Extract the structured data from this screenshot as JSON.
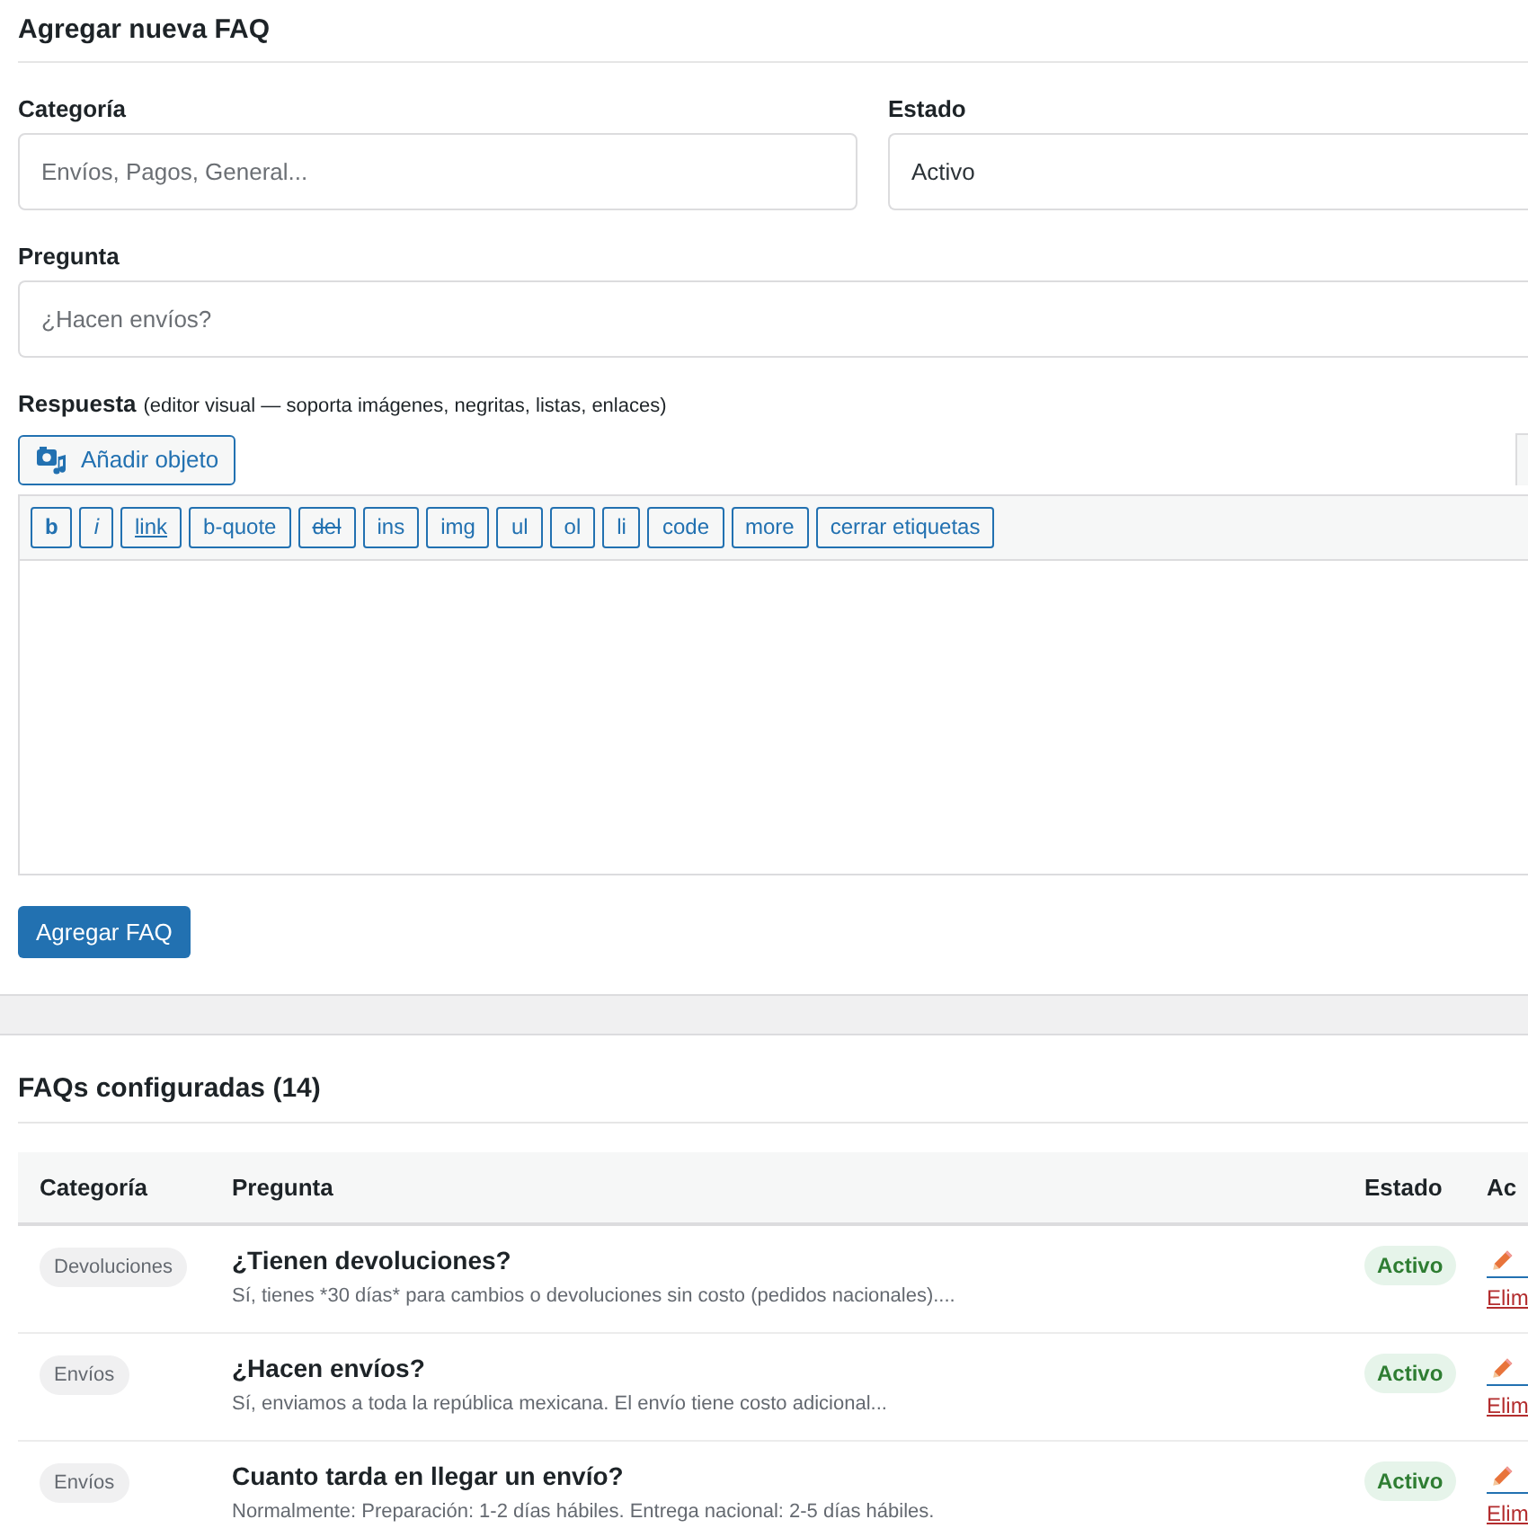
{
  "form": {
    "title": "Agregar nueva FAQ",
    "fields": [
      {
        "label": "Categoría",
        "kind": "text",
        "placeholder": "Envíos, Pagos, General..."
      },
      {
        "label": "Estado",
        "kind": "select",
        "value": "Activo"
      },
      {
        "label": "Pregunta",
        "kind": "text",
        "placeholder": "¿Hacen envíos?"
      }
    ],
    "answer": {
      "label": "Respuesta",
      "hint": "(editor visual — soporta imágenes, negritas, listas, enlaces)",
      "media_button": "Añadir objeto",
      "quicktags": [
        {
          "label": "b",
          "kind": "bold"
        },
        {
          "label": "i",
          "kind": "italic"
        },
        {
          "label": "link",
          "kind": "underline"
        },
        {
          "label": "b-quote",
          "kind": "plain"
        },
        {
          "label": "del",
          "kind": "strike"
        },
        {
          "label": "ins",
          "kind": "plain"
        },
        {
          "label": "img",
          "kind": "plain"
        },
        {
          "label": "ul",
          "kind": "plain"
        },
        {
          "label": "ol",
          "kind": "plain"
        },
        {
          "label": "li",
          "kind": "plain"
        },
        {
          "label": "code",
          "kind": "plain"
        },
        {
          "label": "more",
          "kind": "plain"
        },
        {
          "label": "cerrar etiquetas",
          "kind": "plain"
        }
      ]
    },
    "submit": "Agregar FAQ"
  },
  "list": {
    "title": "FAQs configuradas (14)",
    "columns": [
      "Categoría",
      "Pregunta",
      "Estado",
      "Ac"
    ],
    "rows": [
      {
        "category": "Devoluciones",
        "question": "¿Tienen devoluciones?",
        "excerpt": "Sí, tienes *30 días* para cambios o devoluciones sin costo (pedidos nacionales)....",
        "status": "Activo",
        "active": true,
        "delete": "Elim"
      },
      {
        "category": "Envíos",
        "question": "¿Hacen envíos?",
        "excerpt": "Sí, enviamos a toda la república mexicana. El envío tiene costo adicional...",
        "status": "Activo",
        "active": true,
        "delete": "Elim"
      },
      {
        "category": "Envíos",
        "question": "Cuanto tarda en llegar un envío?",
        "excerpt": "Normalmente: Preparación: 1-2 días hábiles. Entrega nacional: 2-5 días hábiles.",
        "status": "Activo",
        "active": true,
        "delete": "Elim"
      }
    ]
  }
}
